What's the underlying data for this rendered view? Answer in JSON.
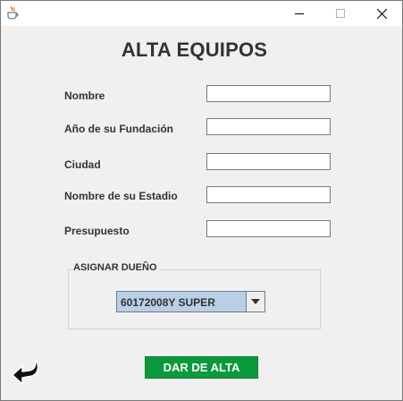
{
  "window": {
    "title": "",
    "app_icon": "java-cup-icon",
    "controls": [
      "minimize-icon",
      "maximize-icon",
      "close-icon"
    ]
  },
  "form": {
    "heading": "ALTA EQUIPOS",
    "fields": [
      {
        "label": "Nombre",
        "value": ""
      },
      {
        "label": "Año de su Fundación",
        "value": ""
      },
      {
        "label": "Ciudad",
        "value": ""
      },
      {
        "label": "Nombre de su Estadio",
        "value": ""
      },
      {
        "label": "Presupuesto",
        "value": ""
      }
    ]
  },
  "owner": {
    "group_title": "ASIGNAR DUEÑO",
    "selected": "60172008Y SUPER",
    "arrow_icon": "chevron-down-icon"
  },
  "actions": {
    "submit_label": "DAR DE ALTA",
    "submit_color": "#0a9a3b",
    "back_icon": "back-arrow-icon"
  }
}
